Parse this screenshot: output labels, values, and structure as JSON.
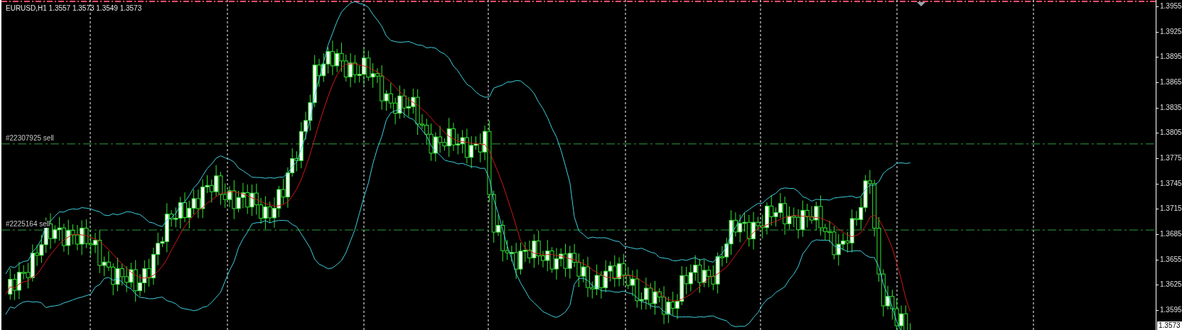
{
  "chart": {
    "symbol_info": "EURUSD,H1  1.3557 1.3573 1.3549 1.3573",
    "orders": [
      {
        "label": "#22307925 sell"
      },
      {
        "label": "#2225164 sell"
      }
    ],
    "price_axis": {
      "labels": [
        "1.3955",
        "1.3925",
        "1.3895",
        "1.3865",
        "1.3835",
        "1.3805",
        "1.3775",
        "1.3745",
        "1.3715",
        "1.3685",
        "1.3655",
        "1.3625",
        "1.3595"
      ]
    },
    "current_price": "1.3573"
  }
}
